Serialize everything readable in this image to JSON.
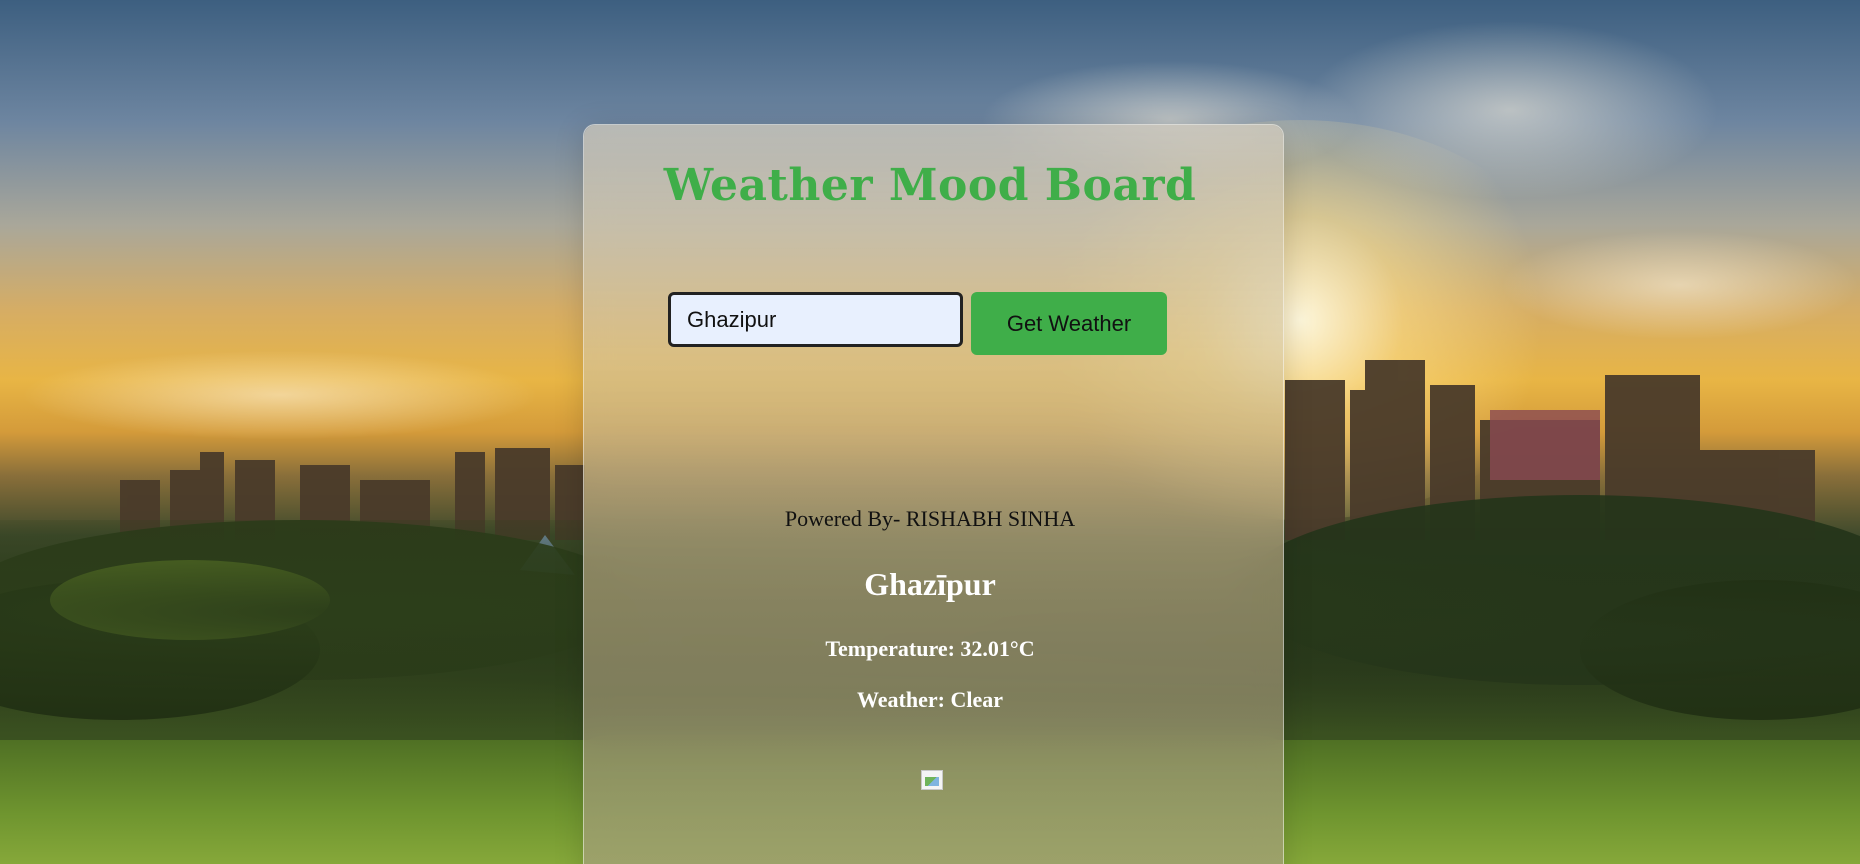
{
  "app": {
    "title": "Weather Mood Board"
  },
  "search": {
    "value": "Ghazipur",
    "button_label": "Get Weather"
  },
  "footer": {
    "powered_by": "Powered By- RISHABH SINHA"
  },
  "weather": {
    "city": "Ghazīpur",
    "temperature": "Temperature: 32.01°C",
    "condition": "Weather: Clear",
    "icon": "broken-image-icon"
  },
  "colors": {
    "accent": "#3fae49",
    "input_bg": "#e8f0fe"
  }
}
